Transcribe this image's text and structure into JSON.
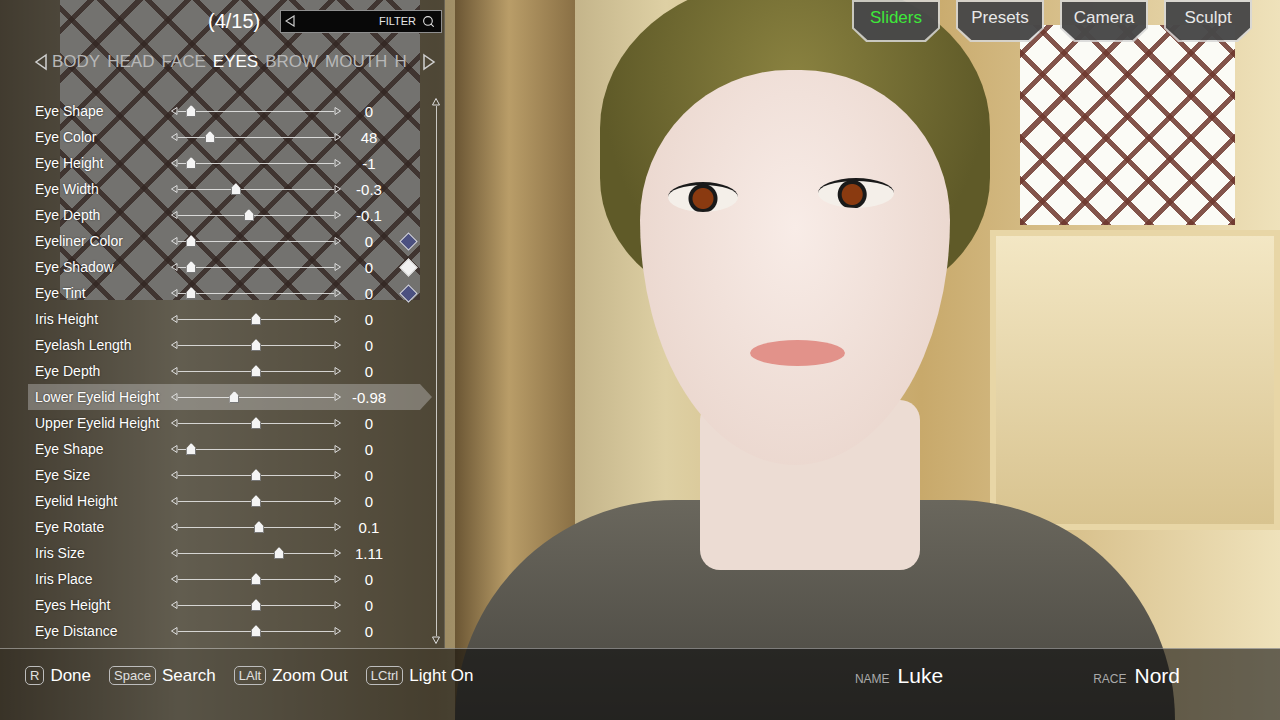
{
  "header": {
    "count": "(4/15)",
    "filter": {
      "placeholder": "FILTER"
    }
  },
  "categories": [
    {
      "label": "BODY",
      "selected": false
    },
    {
      "label": "HEAD",
      "selected": false
    },
    {
      "label": "FACE",
      "selected": false
    },
    {
      "label": "EYES",
      "selected": true
    },
    {
      "label": "BROW",
      "selected": false
    },
    {
      "label": "MOUTH",
      "selected": false
    },
    {
      "label": "H",
      "selected": false
    }
  ],
  "modes": [
    {
      "label": "Sliders",
      "selected": true
    },
    {
      "label": "Presets",
      "selected": false
    },
    {
      "label": "Camera",
      "selected": false
    },
    {
      "label": "Sculpt",
      "selected": false
    }
  ],
  "sliders": [
    {
      "label": "Eye Shape",
      "value": "0",
      "level": 0.05,
      "selected": false
    },
    {
      "label": "Eye Color",
      "value": "48",
      "level": 0.18,
      "selected": false
    },
    {
      "label": "Eye Height",
      "value": "-1",
      "level": 0.05,
      "selected": false
    },
    {
      "label": "Eye Width",
      "value": "-0.3",
      "level": 0.36,
      "selected": false
    },
    {
      "label": "Eye Depth",
      "value": "-0.1",
      "level": 0.45,
      "selected": false
    },
    {
      "label": "Eyeliner Color",
      "value": "0",
      "level": 0.05,
      "selected": false,
      "color": "#4b5080"
    },
    {
      "label": "Eye Shadow",
      "value": "0",
      "level": 0.05,
      "selected": false,
      "color": "#f2f2f2"
    },
    {
      "label": "Eye Tint",
      "value": "0",
      "level": 0.05,
      "selected": false,
      "color": "#4b5080"
    },
    {
      "label": "Iris Height",
      "value": "0",
      "level": 0.5,
      "selected": false
    },
    {
      "label": "Eyelash Length",
      "value": "0",
      "level": 0.5,
      "selected": false
    },
    {
      "label": "Eye Depth",
      "value": "0",
      "level": 0.5,
      "selected": false
    },
    {
      "label": "Lower Eyelid Height",
      "value": "-0.98",
      "level": 0.35,
      "selected": true
    },
    {
      "label": "Upper Eyelid Height",
      "value": "0",
      "level": 0.5,
      "selected": false
    },
    {
      "label": "Eye Shape",
      "value": "0",
      "level": 0.05,
      "selected": false
    },
    {
      "label": "Eye Size",
      "value": "0",
      "level": 0.5,
      "selected": false
    },
    {
      "label": "Eyelid Height",
      "value": "0",
      "level": 0.5,
      "selected": false
    },
    {
      "label": "Eye Rotate",
      "value": "0.1",
      "level": 0.52,
      "selected": false
    },
    {
      "label": "Iris Size",
      "value": "1.11",
      "level": 0.66,
      "selected": false
    },
    {
      "label": "Iris Place",
      "value": "0",
      "level": 0.5,
      "selected": false
    },
    {
      "label": "Eyes Height",
      "value": "0",
      "level": 0.5,
      "selected": false
    },
    {
      "label": "Eye Distance",
      "value": "0",
      "level": 0.5,
      "selected": false
    }
  ],
  "controls": [
    {
      "key": "R",
      "label": "Done"
    },
    {
      "key": "Space",
      "label": "Search"
    },
    {
      "key": "LAlt",
      "label": "Zoom Out"
    },
    {
      "key": "LCtrl",
      "label": "Light On"
    }
  ],
  "character": {
    "name_label": "NAME",
    "name": "Luke",
    "race_label": "RACE",
    "race": "Nord"
  }
}
